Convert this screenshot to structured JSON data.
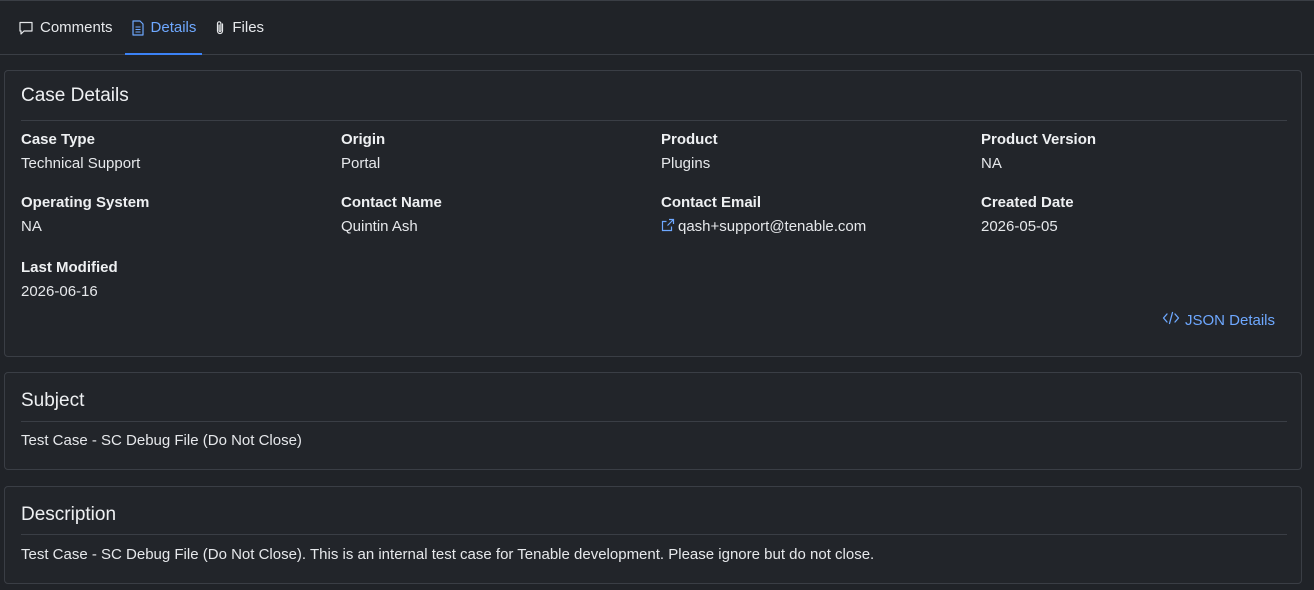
{
  "tabs": [
    {
      "label": "Comments",
      "icon": "comment-icon",
      "active": false
    },
    {
      "label": "Details",
      "icon": "document-icon",
      "active": true
    },
    {
      "label": "Files",
      "icon": "paperclip-icon",
      "active": false
    }
  ],
  "case_details": {
    "title": "Case Details",
    "fields": [
      {
        "label": "Case Type",
        "value": "Technical Support"
      },
      {
        "label": "Origin",
        "value": "Portal"
      },
      {
        "label": "Product",
        "value": "Plugins"
      },
      {
        "label": "Product Version",
        "value": "NA"
      },
      {
        "label": "Operating System",
        "value": "NA"
      },
      {
        "label": "Contact Name",
        "value": "Quintin Ash"
      },
      {
        "label": "Contact Email",
        "value": "qash+support@tenable.com"
      },
      {
        "label": "Created Date",
        "value": "2026-05-05"
      },
      {
        "label": "Last Modified",
        "value": "2026-06-16"
      }
    ],
    "json_link": "JSON Details"
  },
  "subject": {
    "title": "Subject",
    "text": "Test Case - SC Debug File (Do Not Close)"
  },
  "description": {
    "title": "Description",
    "text": "Test Case - SC Debug File (Do Not Close). This is an internal test case for Tenable development. Please ignore but do not close."
  },
  "colors": {
    "background": "#202328",
    "accent": "#6ea8ff",
    "border": "#3a3e45"
  }
}
